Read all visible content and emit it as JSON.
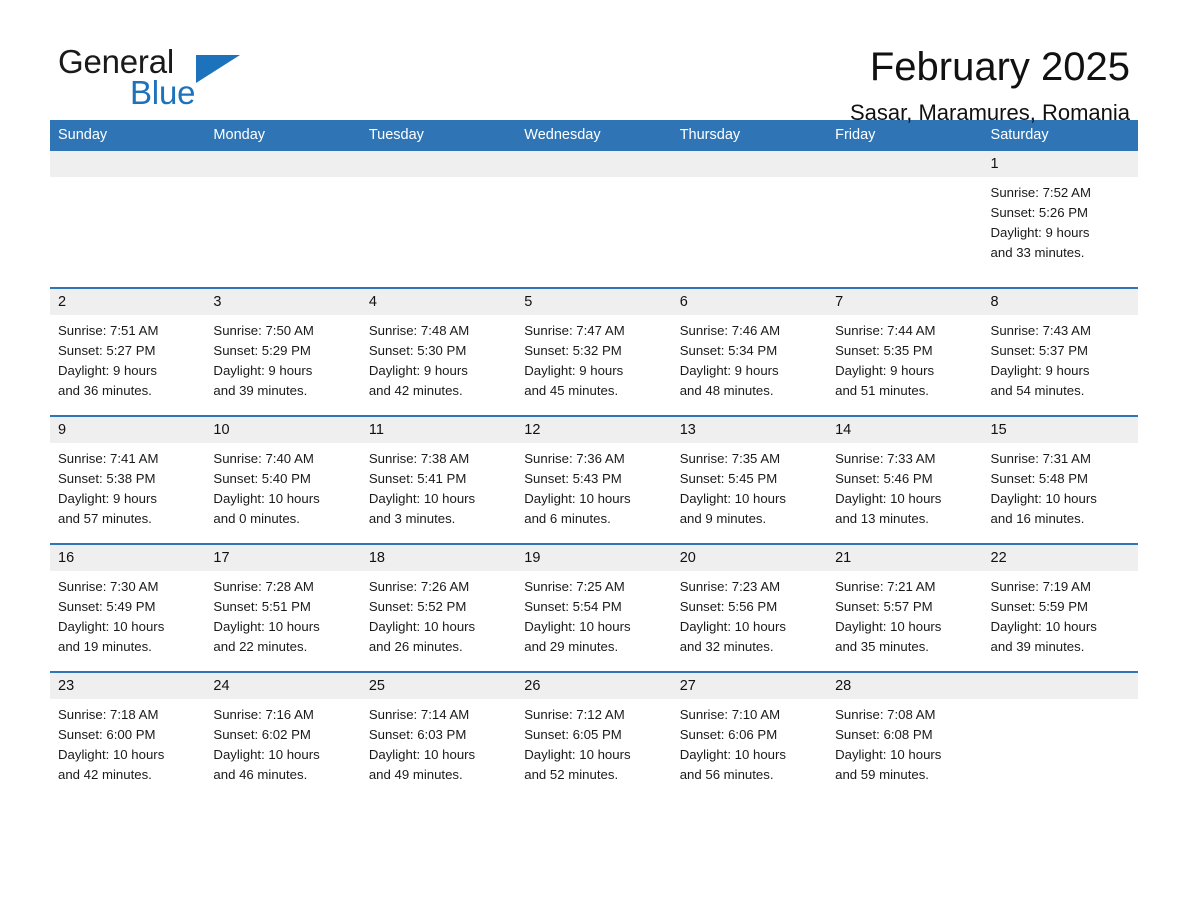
{
  "brand": {
    "name_part1": "General",
    "name_part2": "Blue",
    "flag_icon": "triangle-flag-icon",
    "accent_color": "#1c72bb"
  },
  "header": {
    "month_title": "February 2025",
    "location": "Sasar, Maramures, Romania"
  },
  "calendar": {
    "header_color": "#2f75b5",
    "date_band_color": "#efefef",
    "weekdays": [
      "Sunday",
      "Monday",
      "Tuesday",
      "Wednesday",
      "Thursday",
      "Friday",
      "Saturday"
    ],
    "weeks": [
      [
        {
          "date": "",
          "sunrise": "",
          "sunset": "",
          "daylight_line1": "",
          "daylight_line2": "",
          "empty": true
        },
        {
          "date": "",
          "sunrise": "",
          "sunset": "",
          "daylight_line1": "",
          "daylight_line2": "",
          "empty": true
        },
        {
          "date": "",
          "sunrise": "",
          "sunset": "",
          "daylight_line1": "",
          "daylight_line2": "",
          "empty": true
        },
        {
          "date": "",
          "sunrise": "",
          "sunset": "",
          "daylight_line1": "",
          "daylight_line2": "",
          "empty": true
        },
        {
          "date": "",
          "sunrise": "",
          "sunset": "",
          "daylight_line1": "",
          "daylight_line2": "",
          "empty": true
        },
        {
          "date": "",
          "sunrise": "",
          "sunset": "",
          "daylight_line1": "",
          "daylight_line2": "",
          "empty": true
        },
        {
          "date": "1",
          "sunrise": "Sunrise: 7:52 AM",
          "sunset": "Sunset: 5:26 PM",
          "daylight_line1": "Daylight: 9 hours",
          "daylight_line2": "and 33 minutes.",
          "empty": false
        }
      ],
      [
        {
          "date": "2",
          "sunrise": "Sunrise: 7:51 AM",
          "sunset": "Sunset: 5:27 PM",
          "daylight_line1": "Daylight: 9 hours",
          "daylight_line2": "and 36 minutes.",
          "empty": false
        },
        {
          "date": "3",
          "sunrise": "Sunrise: 7:50 AM",
          "sunset": "Sunset: 5:29 PM",
          "daylight_line1": "Daylight: 9 hours",
          "daylight_line2": "and 39 minutes.",
          "empty": false
        },
        {
          "date": "4",
          "sunrise": "Sunrise: 7:48 AM",
          "sunset": "Sunset: 5:30 PM",
          "daylight_line1": "Daylight: 9 hours",
          "daylight_line2": "and 42 minutes.",
          "empty": false
        },
        {
          "date": "5",
          "sunrise": "Sunrise: 7:47 AM",
          "sunset": "Sunset: 5:32 PM",
          "daylight_line1": "Daylight: 9 hours",
          "daylight_line2": "and 45 minutes.",
          "empty": false
        },
        {
          "date": "6",
          "sunrise": "Sunrise: 7:46 AM",
          "sunset": "Sunset: 5:34 PM",
          "daylight_line1": "Daylight: 9 hours",
          "daylight_line2": "and 48 minutes.",
          "empty": false
        },
        {
          "date": "7",
          "sunrise": "Sunrise: 7:44 AM",
          "sunset": "Sunset: 5:35 PM",
          "daylight_line1": "Daylight: 9 hours",
          "daylight_line2": "and 51 minutes.",
          "empty": false
        },
        {
          "date": "8",
          "sunrise": "Sunrise: 7:43 AM",
          "sunset": "Sunset: 5:37 PM",
          "daylight_line1": "Daylight: 9 hours",
          "daylight_line2": "and 54 minutes.",
          "empty": false
        }
      ],
      [
        {
          "date": "9",
          "sunrise": "Sunrise: 7:41 AM",
          "sunset": "Sunset: 5:38 PM",
          "daylight_line1": "Daylight: 9 hours",
          "daylight_line2": "and 57 minutes.",
          "empty": false
        },
        {
          "date": "10",
          "sunrise": "Sunrise: 7:40 AM",
          "sunset": "Sunset: 5:40 PM",
          "daylight_line1": "Daylight: 10 hours",
          "daylight_line2": "and 0 minutes.",
          "empty": false
        },
        {
          "date": "11",
          "sunrise": "Sunrise: 7:38 AM",
          "sunset": "Sunset: 5:41 PM",
          "daylight_line1": "Daylight: 10 hours",
          "daylight_line2": "and 3 minutes.",
          "empty": false
        },
        {
          "date": "12",
          "sunrise": "Sunrise: 7:36 AM",
          "sunset": "Sunset: 5:43 PM",
          "daylight_line1": "Daylight: 10 hours",
          "daylight_line2": "and 6 minutes.",
          "empty": false
        },
        {
          "date": "13",
          "sunrise": "Sunrise: 7:35 AM",
          "sunset": "Sunset: 5:45 PM",
          "daylight_line1": "Daylight: 10 hours",
          "daylight_line2": "and 9 minutes.",
          "empty": false
        },
        {
          "date": "14",
          "sunrise": "Sunrise: 7:33 AM",
          "sunset": "Sunset: 5:46 PM",
          "daylight_line1": "Daylight: 10 hours",
          "daylight_line2": "and 13 minutes.",
          "empty": false
        },
        {
          "date": "15",
          "sunrise": "Sunrise: 7:31 AM",
          "sunset": "Sunset: 5:48 PM",
          "daylight_line1": "Daylight: 10 hours",
          "daylight_line2": "and 16 minutes.",
          "empty": false
        }
      ],
      [
        {
          "date": "16",
          "sunrise": "Sunrise: 7:30 AM",
          "sunset": "Sunset: 5:49 PM",
          "daylight_line1": "Daylight: 10 hours",
          "daylight_line2": "and 19 minutes.",
          "empty": false
        },
        {
          "date": "17",
          "sunrise": "Sunrise: 7:28 AM",
          "sunset": "Sunset: 5:51 PM",
          "daylight_line1": "Daylight: 10 hours",
          "daylight_line2": "and 22 minutes.",
          "empty": false
        },
        {
          "date": "18",
          "sunrise": "Sunrise: 7:26 AM",
          "sunset": "Sunset: 5:52 PM",
          "daylight_line1": "Daylight: 10 hours",
          "daylight_line2": "and 26 minutes.",
          "empty": false
        },
        {
          "date": "19",
          "sunrise": "Sunrise: 7:25 AM",
          "sunset": "Sunset: 5:54 PM",
          "daylight_line1": "Daylight: 10 hours",
          "daylight_line2": "and 29 minutes.",
          "empty": false
        },
        {
          "date": "20",
          "sunrise": "Sunrise: 7:23 AM",
          "sunset": "Sunset: 5:56 PM",
          "daylight_line1": "Daylight: 10 hours",
          "daylight_line2": "and 32 minutes.",
          "empty": false
        },
        {
          "date": "21",
          "sunrise": "Sunrise: 7:21 AM",
          "sunset": "Sunset: 5:57 PM",
          "daylight_line1": "Daylight: 10 hours",
          "daylight_line2": "and 35 minutes.",
          "empty": false
        },
        {
          "date": "22",
          "sunrise": "Sunrise: 7:19 AM",
          "sunset": "Sunset: 5:59 PM",
          "daylight_line1": "Daylight: 10 hours",
          "daylight_line2": "and 39 minutes.",
          "empty": false
        }
      ],
      [
        {
          "date": "23",
          "sunrise": "Sunrise: 7:18 AM",
          "sunset": "Sunset: 6:00 PM",
          "daylight_line1": "Daylight: 10 hours",
          "daylight_line2": "and 42 minutes.",
          "empty": false
        },
        {
          "date": "24",
          "sunrise": "Sunrise: 7:16 AM",
          "sunset": "Sunset: 6:02 PM",
          "daylight_line1": "Daylight: 10 hours",
          "daylight_line2": "and 46 minutes.",
          "empty": false
        },
        {
          "date": "25",
          "sunrise": "Sunrise: 7:14 AM",
          "sunset": "Sunset: 6:03 PM",
          "daylight_line1": "Daylight: 10 hours",
          "daylight_line2": "and 49 minutes.",
          "empty": false
        },
        {
          "date": "26",
          "sunrise": "Sunrise: 7:12 AM",
          "sunset": "Sunset: 6:05 PM",
          "daylight_line1": "Daylight: 10 hours",
          "daylight_line2": "and 52 minutes.",
          "empty": false
        },
        {
          "date": "27",
          "sunrise": "Sunrise: 7:10 AM",
          "sunset": "Sunset: 6:06 PM",
          "daylight_line1": "Daylight: 10 hours",
          "daylight_line2": "and 56 minutes.",
          "empty": false
        },
        {
          "date": "28",
          "sunrise": "Sunrise: 7:08 AM",
          "sunset": "Sunset: 6:08 PM",
          "daylight_line1": "Daylight: 10 hours",
          "daylight_line2": "and 59 minutes.",
          "empty": false
        },
        {
          "date": "",
          "sunrise": "",
          "sunset": "",
          "daylight_line1": "",
          "daylight_line2": "",
          "empty": true
        }
      ]
    ]
  }
}
